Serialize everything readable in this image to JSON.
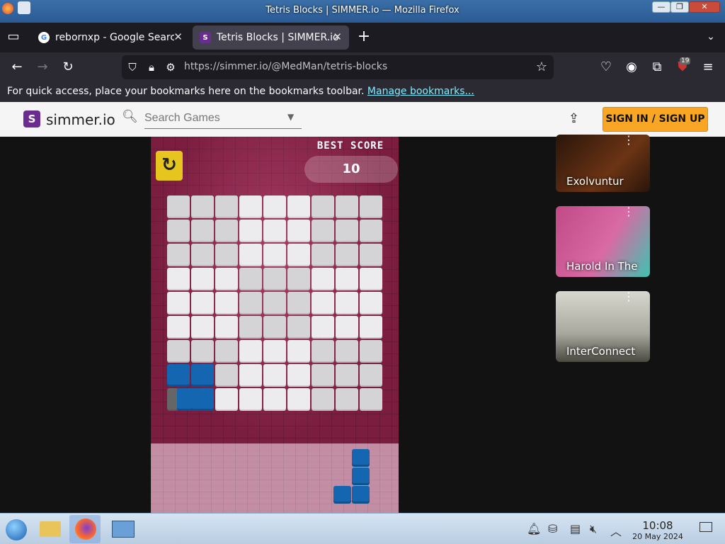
{
  "window": {
    "title": "Tetris Blocks | SIMMER.io — Mozilla Firefox",
    "minimize": "—",
    "restore": "❐",
    "close": "✕"
  },
  "tabs": [
    {
      "label": "rebornxp - Google Search",
      "favicon": "G",
      "active": false
    },
    {
      "label": "Tetris Blocks | SIMMER.io",
      "favicon": "S",
      "active": true
    }
  ],
  "new_tab": "+",
  "nav": {
    "url": "https://simmer.io/@MedMan/tetris-blocks",
    "extension_badge": "19"
  },
  "bookmarks_bar": {
    "message": "For quick access, place your bookmarks here on the bookmarks toolbar.",
    "link": "Manage bookmarks..."
  },
  "site": {
    "logo_letter": "S",
    "logo_text": "simmer.io",
    "search_placeholder": "Search Games",
    "signin": "SIGN IN / SIGN UP"
  },
  "game": {
    "best_score_label": "BEST SCORE",
    "best_score": "10",
    "board_rows": [
      "dddlllddd",
      "dddlllddd",
      "dddlllddd",
      "llldddlll",
      "llldddlll",
      "llldddlll",
      "dddlllddd",
      "bbdlllddd",
      "gbbllllddd"
    ]
  },
  "sidebar": {
    "games": [
      {
        "title": "Exolvuntur",
        "colors": [
          "#3b2210",
          "#b85a1a"
        ]
      },
      {
        "title": "Harold In The",
        "colors": [
          "#b03a78",
          "#2fb0a0"
        ]
      },
      {
        "title": "InterConnect",
        "colors": [
          "#cfcfc8",
          "#5a5a52"
        ]
      }
    ]
  },
  "taskbar": {
    "time": "10:08",
    "date": "20 May 2024"
  }
}
